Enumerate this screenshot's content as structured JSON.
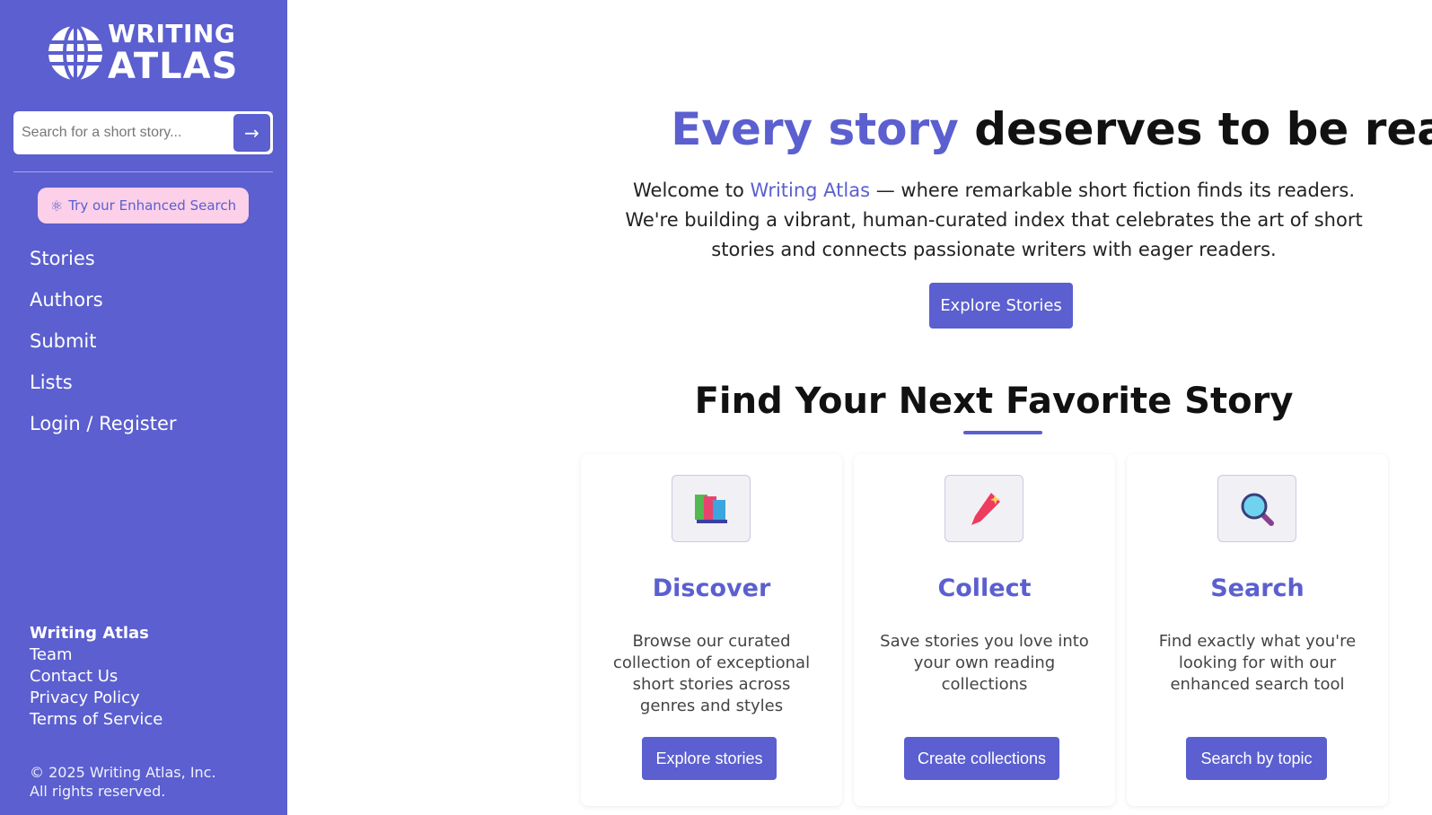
{
  "sidebar": {
    "logo": {
      "line1": "WRITING",
      "line2": "ATLAS"
    },
    "search": {
      "placeholder": "Search for a short story...",
      "submit_icon": "arrow-right-icon"
    },
    "enhanced_search": {
      "label": "Try our Enhanced Search",
      "icon": "atom-icon"
    },
    "nav": [
      {
        "label": "Stories"
      },
      {
        "label": "Authors"
      },
      {
        "label": "Submit"
      },
      {
        "label": "Lists"
      },
      {
        "label": "Login / Register"
      }
    ],
    "footer": {
      "heading": "Writing Atlas",
      "links": [
        "Team",
        "Contact Us",
        "Privacy Policy",
        "Terms of Service"
      ],
      "copyright": "© 2025 Writing Atlas, Inc. All rights reserved."
    }
  },
  "hero": {
    "title_accent": "Every story",
    "title_rest": "deserves to be read.",
    "text_before": "Welcome to",
    "text_brand": "Writing Atlas",
    "text_after": "— where remarkable short fiction finds its readers.",
    "text_line2": "We're building a vibrant, human-curated index that celebrates the art of short stories and connects passionate writers with eager readers.",
    "button_label": "Explore Stories"
  },
  "features": {
    "title": "Find Your Next Favorite Story",
    "cards": [
      {
        "icon": "books-icon",
        "title": "Discover",
        "description": "Browse our curated collection of exceptional short stories across genres and styles",
        "button": "Explore stories"
      },
      {
        "icon": "bookmark-icon",
        "title": "Collect",
        "description": "Save stories you love into your own reading collections",
        "button": "Create collections"
      },
      {
        "icon": "magnifier-icon",
        "title": "Search",
        "description": "Find exactly what you're looking for with our enhanced search tool",
        "button": "Search by topic"
      }
    ]
  },
  "colors": {
    "brand": "#5b5fcf",
    "enhanced_bg": "#fbd0e8"
  }
}
